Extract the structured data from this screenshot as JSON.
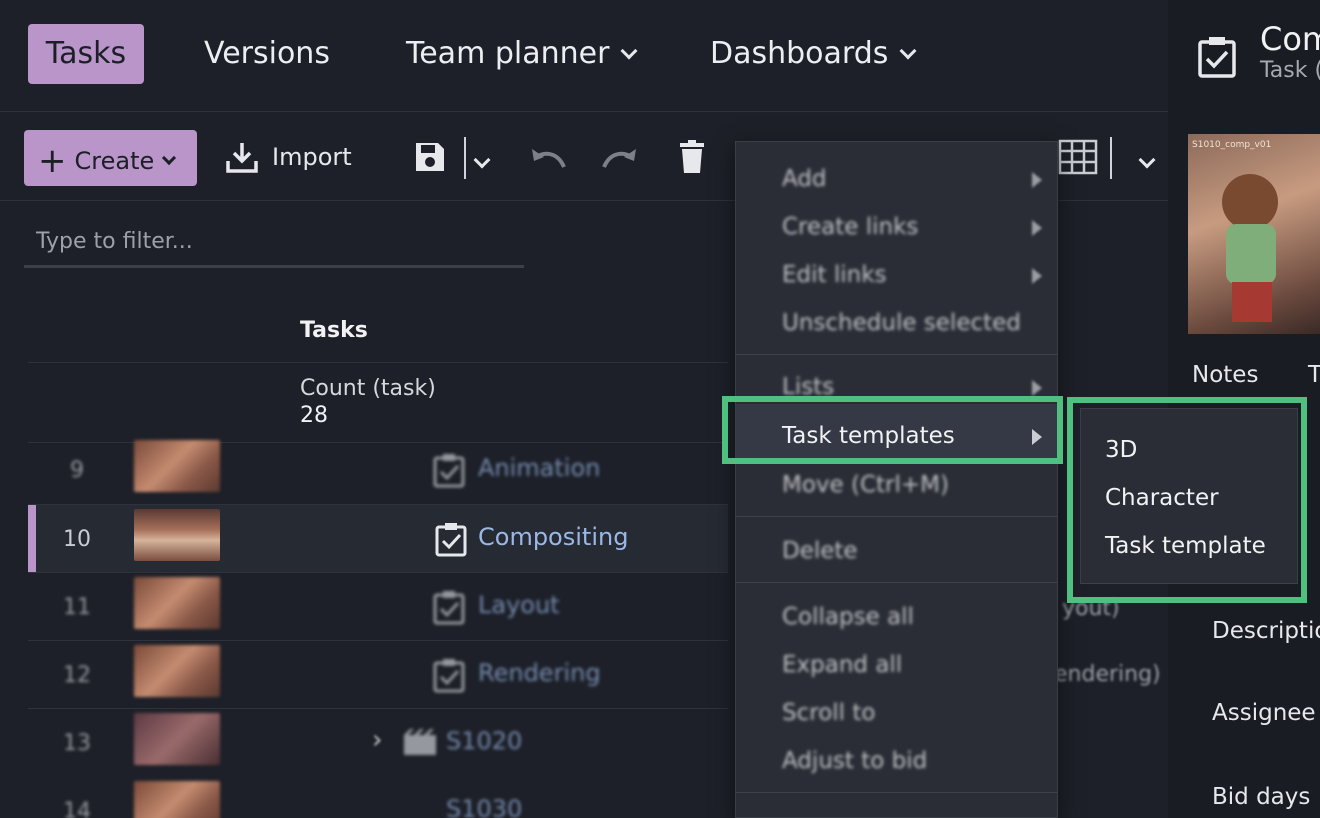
{
  "nav": {
    "tabs": [
      {
        "label": "Tasks",
        "active": true
      },
      {
        "label": "Versions"
      },
      {
        "label": "Team planner"
      },
      {
        "label": "Dashboards"
      }
    ]
  },
  "toolbar": {
    "create_label": "Create",
    "import_label": "Import"
  },
  "filter": {
    "placeholder": "Type to filter..."
  },
  "table": {
    "column_header": "Tasks",
    "count_label": "Count (task)",
    "count_value": "28",
    "rows": [
      {
        "num": "9",
        "name": "Animation"
      },
      {
        "num": "10",
        "name": "Compositing"
      },
      {
        "num": "11",
        "name": "Layout"
      },
      {
        "num": "12",
        "name": "Rendering"
      },
      {
        "num": "13",
        "name": "S1020"
      },
      {
        "num": "14",
        "name": "S1030"
      }
    ],
    "side_text_1": "yout)",
    "side_text_2": "endering)"
  },
  "context_menu": {
    "items": [
      "Add",
      "Create links",
      "Edit links",
      "Unschedule selected",
      "Lists",
      "Task templates",
      "Move (Ctrl+M)",
      "Delete",
      "Collapse all",
      "Expand all",
      "Scroll to",
      "Adjust to bid"
    ]
  },
  "submenu": {
    "items": [
      "3D",
      "Character",
      "Task template"
    ]
  },
  "panel": {
    "title": "Com",
    "subtitle": "Task (",
    "thumb_caption": "S1010_comp_v01",
    "tab_notes": "Notes",
    "tab_t": "T",
    "fields": [
      "Descriptio",
      "Assignee",
      "Bid days"
    ]
  },
  "colors": {
    "accent": "#b995c9",
    "highlight": "#4fc07f",
    "link": "#9ab7e6"
  }
}
